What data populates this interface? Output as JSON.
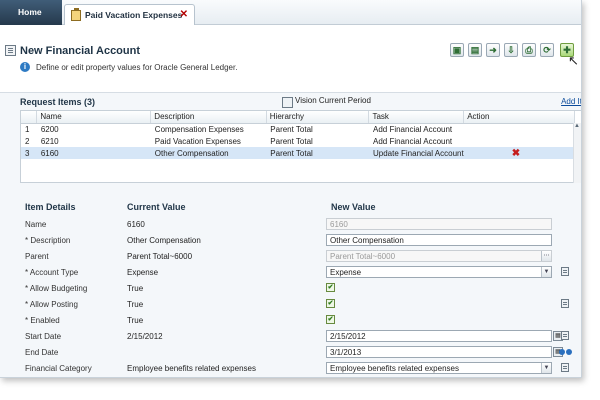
{
  "tabs": {
    "home": "Home",
    "active": "Paid Vacation Expenses",
    "close": "✕"
  },
  "header": {
    "title": "New Financial Account",
    "info": "Define or edit property values for Oracle General Ledger.",
    "info_icon": "i"
  },
  "toolbar": {
    "icons": [
      "save-icon",
      "excel-icon",
      "submit-icon",
      "export-icon",
      "print-icon",
      "refresh-icon",
      "add-icon"
    ]
  },
  "request": {
    "title": "Request Items (3)",
    "period": "Vision Current Period",
    "add_link": "Add It",
    "columns": [
      "Name",
      "Description",
      "Hierarchy",
      "Task",
      "Action"
    ],
    "rows": [
      {
        "num": "1",
        "name": "6200",
        "description": "Compensation Expenses",
        "hierarchy": "Parent Total",
        "task": "Add Financial Account",
        "action": ""
      },
      {
        "num": "2",
        "name": "6210",
        "description": "Paid Vacation Expenses",
        "hierarchy": "Parent Total",
        "task": "Add Financial Account",
        "action": ""
      },
      {
        "num": "3",
        "name": "6160",
        "description": "Other Compensation",
        "hierarchy": "Parent Total",
        "task": "Update Financial Account",
        "action": "✖"
      }
    ]
  },
  "details": {
    "headings": {
      "item": "Item Details",
      "current": "Current Value",
      "new": "New Value"
    },
    "rows": [
      {
        "label": "Name",
        "current": "6160",
        "new": "6160"
      },
      {
        "label": "* Description",
        "current": "Other Compensation",
        "new": "Other Compensation"
      },
      {
        "label": "Parent",
        "current": "Parent Total~6000",
        "new": "Parent Total~6000"
      },
      {
        "label": "* Account Type",
        "current": "Expense",
        "new": "Expense"
      },
      {
        "label": "* Allow Budgeting",
        "current": "True",
        "new": "✔"
      },
      {
        "label": "* Allow Posting",
        "current": "True",
        "new": "✔"
      },
      {
        "label": "* Enabled",
        "current": "True",
        "new": "✔"
      },
      {
        "label": "Start Date",
        "current": "2/15/2012",
        "new": "2/15/2012"
      },
      {
        "label": "End Date",
        "current": "",
        "new": "3/1/2013"
      },
      {
        "label": "Financial Category",
        "current": "Employee benefits related expenses",
        "new": "Employee benefits related expenses"
      }
    ]
  }
}
